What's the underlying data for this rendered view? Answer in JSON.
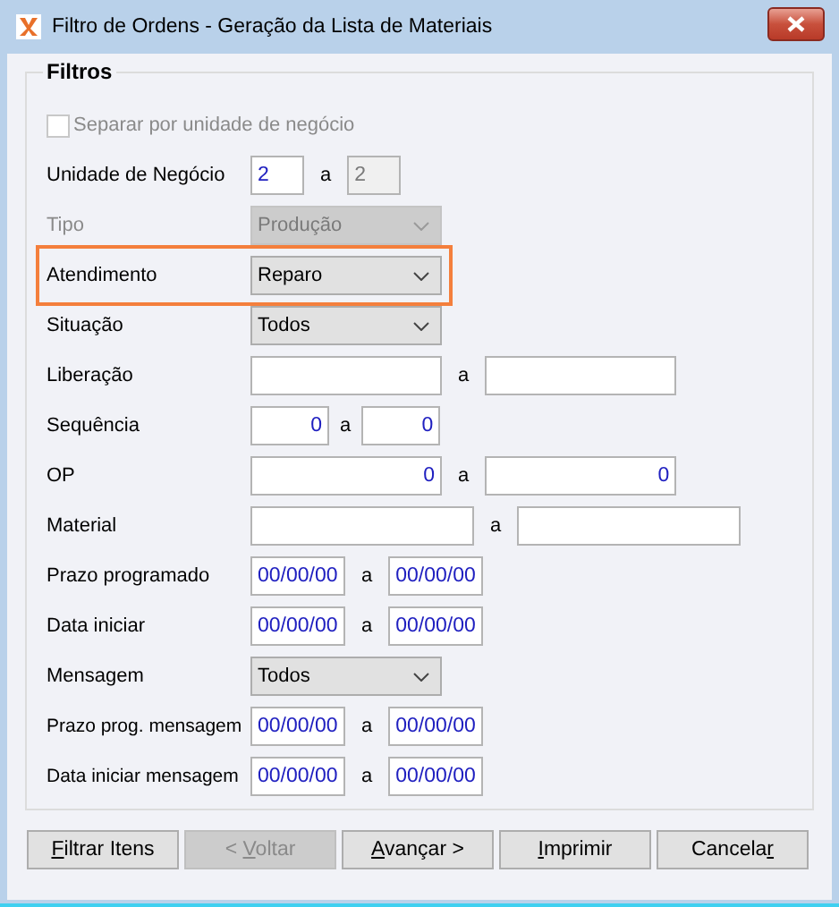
{
  "window": {
    "title": "Filtro de Ordens - Geração da Lista de Materiais"
  },
  "group": {
    "title": "Filtros"
  },
  "rows": [
    {
      "kind": "checkbox",
      "label": "Separar por unidade de negócio",
      "checked": false,
      "disabled": true,
      "highlighted": false
    },
    {
      "kind": "unit_range",
      "label": "Unidade de Negócio",
      "separator": "a",
      "from": {
        "value": "2",
        "disabled": false
      },
      "to": {
        "value": "2",
        "disabled": true
      },
      "highlighted": false
    },
    {
      "kind": "select",
      "label": "Tipo",
      "value": "Produção",
      "disabled": true,
      "highlighted": false
    },
    {
      "kind": "select",
      "label": "Atendimento",
      "value": "Reparo",
      "disabled": false,
      "highlighted": true
    },
    {
      "kind": "select",
      "label": "Situação",
      "value": "Todos",
      "disabled": false,
      "highlighted": false
    },
    {
      "kind": "text_range",
      "label": "Liberação",
      "separator": "a",
      "from": {
        "disabled": false
      },
      "to": {
        "disabled": false
      },
      "highlighted": false
    },
    {
      "kind": "short_number_range",
      "label": "Sequência",
      "separator": "a",
      "from": {
        "value": "0",
        "disabled": false
      },
      "to": {
        "value": "0",
        "disabled": false
      },
      "highlighted": false
    },
    {
      "kind": "number_range",
      "label": "OP",
      "separator": "a",
      "from": {
        "value": "0",
        "disabled": false
      },
      "to": {
        "value": "0",
        "disabled": false
      },
      "highlighted": false
    },
    {
      "kind": "wide_text_range",
      "label": "Material",
      "separator": "a",
      "from": {
        "disabled": false
      },
      "to": {
        "disabled": false
      },
      "highlighted": false
    },
    {
      "kind": "date_range",
      "label": "Prazo programado",
      "separator": "a",
      "from": {
        "value": "00/00/00",
        "disabled": false
      },
      "to": {
        "value": "00/00/00",
        "disabled": false
      },
      "highlighted": false
    },
    {
      "kind": "date_range",
      "label": "Data iniciar",
      "separator": "a",
      "from": {
        "value": "00/00/00",
        "disabled": false
      },
      "to": {
        "value": "00/00/00",
        "disabled": false
      },
      "highlighted": false
    },
    {
      "kind": "select",
      "label": "Mensagem",
      "value": "Todos",
      "disabled": false,
      "highlighted": false
    },
    {
      "kind": "date_range",
      "label": "Prazo prog. mensagem",
      "separator": "a",
      "from": {
        "value": "00/00/00",
        "disabled": false
      },
      "to": {
        "value": "00/00/00",
        "disabled": false
      },
      "highlighted": false
    },
    {
      "kind": "date_range",
      "label": "Data iniciar mensagem",
      "separator": "a",
      "from": {
        "value": "00/00/00",
        "disabled": false
      },
      "to": {
        "value": "00/00/00",
        "disabled": false
      },
      "highlighted": false
    }
  ],
  "buttons": [
    {
      "key": "F",
      "post": "iltrar Itens",
      "disabled": false
    },
    {
      "pre": "< ",
      "key": "V",
      "post": "oltar",
      "disabled": true
    },
    {
      "key": "A",
      "post": "vançar >",
      "disabled": false
    },
    {
      "key": "I",
      "post": "mprimir",
      "disabled": false
    },
    {
      "pre": "Cancela",
      "key": "r",
      "disabled": false
    }
  ]
}
